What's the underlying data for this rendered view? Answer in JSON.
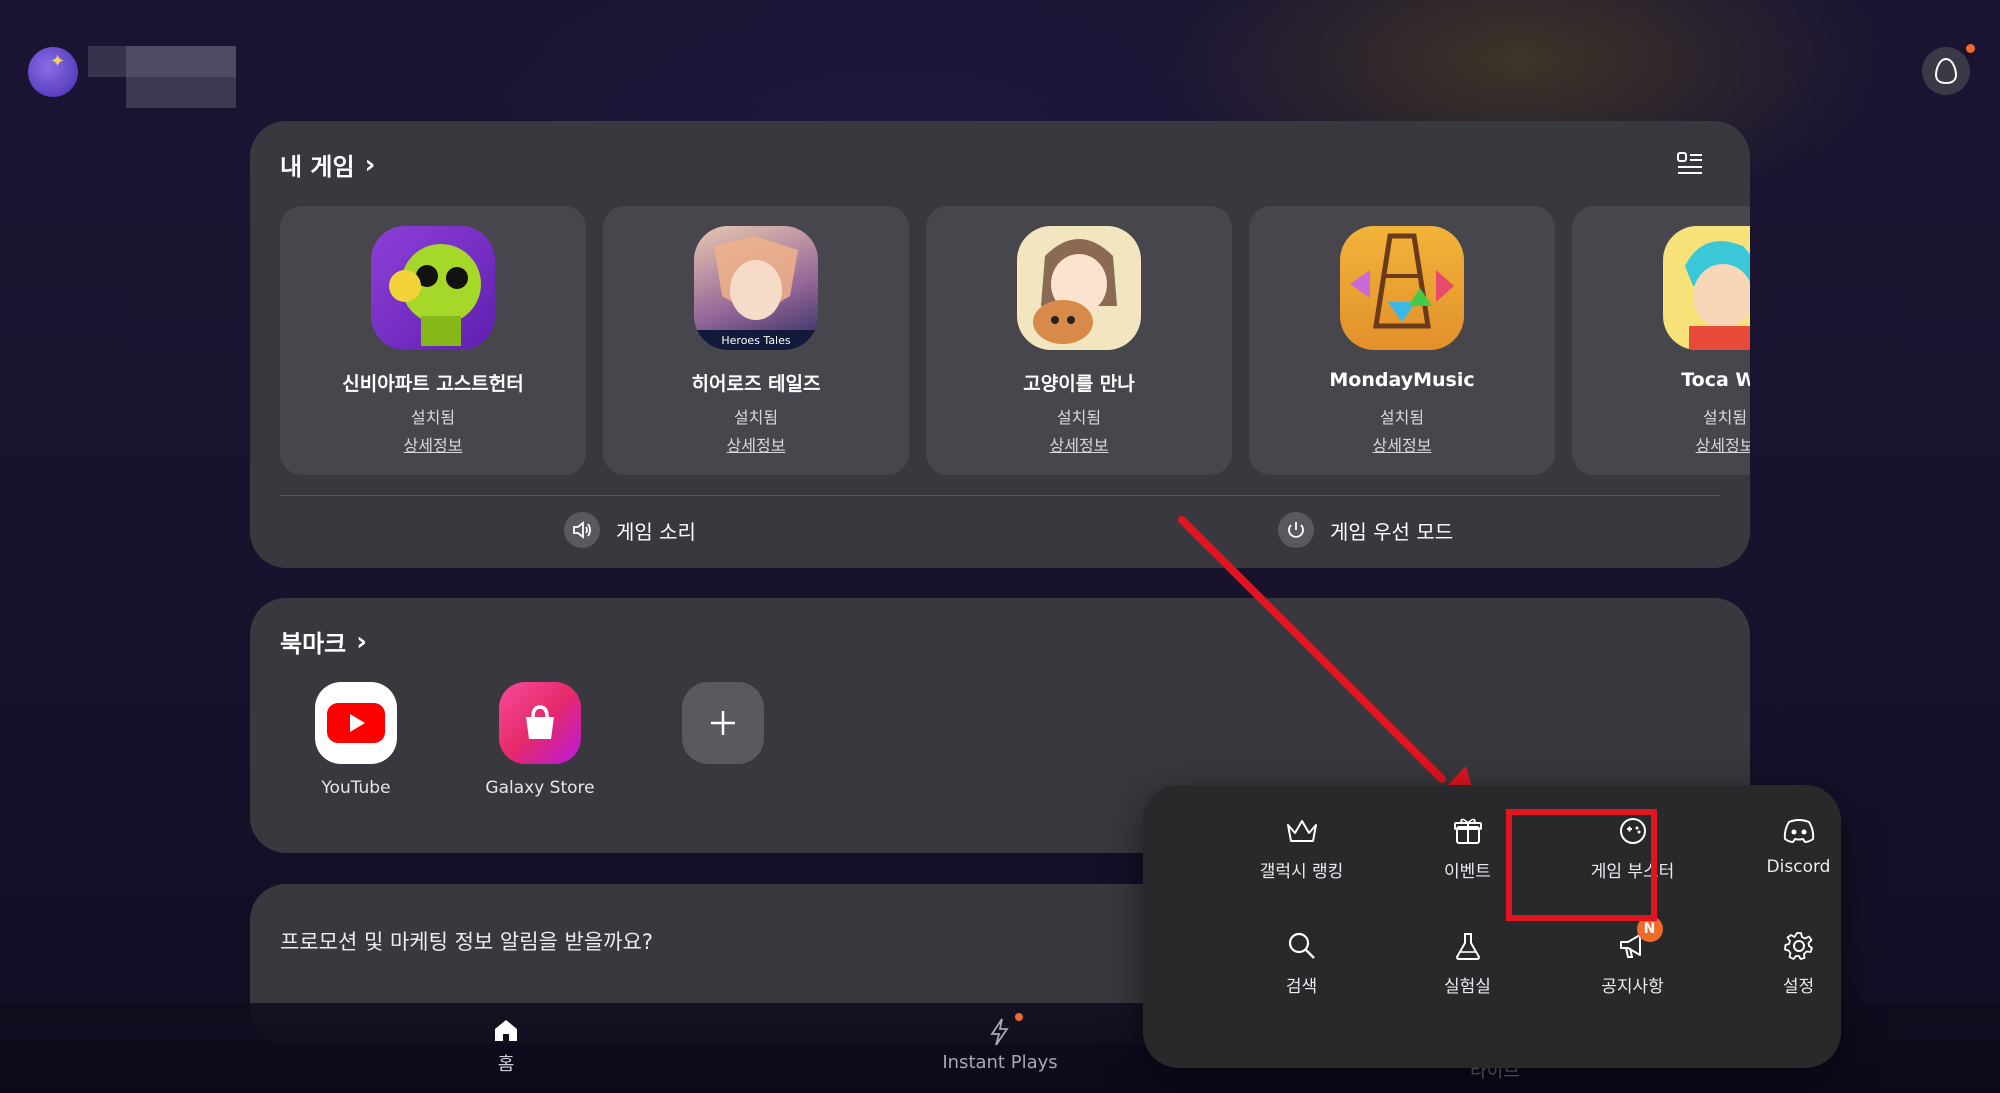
{
  "header": {
    "avatar": "profile-avatar",
    "username_blurred": true
  },
  "my_games": {
    "title": "내 게임",
    "games": [
      {
        "name": "신비아파트 고스트헌터",
        "status": "설치됨",
        "detail": "상세정보"
      },
      {
        "name": "히어로즈 테일즈",
        "status": "설치됨",
        "detail": "상세정보",
        "icon_caption": "Heroes Tales"
      },
      {
        "name": "고양이를 만나",
        "status": "설치됨",
        "detail": "상세정보"
      },
      {
        "name": "MondayMusic",
        "status": "설치됨",
        "detail": "상세정보"
      },
      {
        "name": "Toca Wo",
        "status": "설치됨",
        "detail": "상세정보"
      }
    ],
    "sound_label": "게임 소리",
    "priority_label": "게임 우선 모드"
  },
  "bookmarks": {
    "title": "북마크",
    "items": [
      {
        "label": "YouTube"
      },
      {
        "label": "Galaxy Store"
      }
    ]
  },
  "promo": {
    "text": "프로모션 및 마케팅 정보 알림을 받을까요?"
  },
  "bottom_nav": {
    "items": [
      {
        "label": "홈"
      },
      {
        "label": "Instant Plays"
      },
      {
        "label": "라이브"
      }
    ]
  },
  "popup_menu": {
    "items": [
      {
        "label": "갤럭시 랭킹",
        "icon": "crown-icon"
      },
      {
        "label": "이벤트",
        "icon": "gift-icon"
      },
      {
        "label": "게임 부스터",
        "icon": "booster-icon"
      },
      {
        "label": "Discord",
        "icon": "discord-icon"
      },
      {
        "label": "검색",
        "icon": "search-icon"
      },
      {
        "label": "실험실",
        "icon": "flask-icon"
      },
      {
        "label": "공지사항",
        "icon": "megaphone-icon",
        "badge": "N"
      },
      {
        "label": "설정",
        "icon": "gear-icon"
      }
    ]
  },
  "colors": {
    "accent": "#f06a2b",
    "highlight": "#e0151f",
    "panel": "#39383e"
  }
}
